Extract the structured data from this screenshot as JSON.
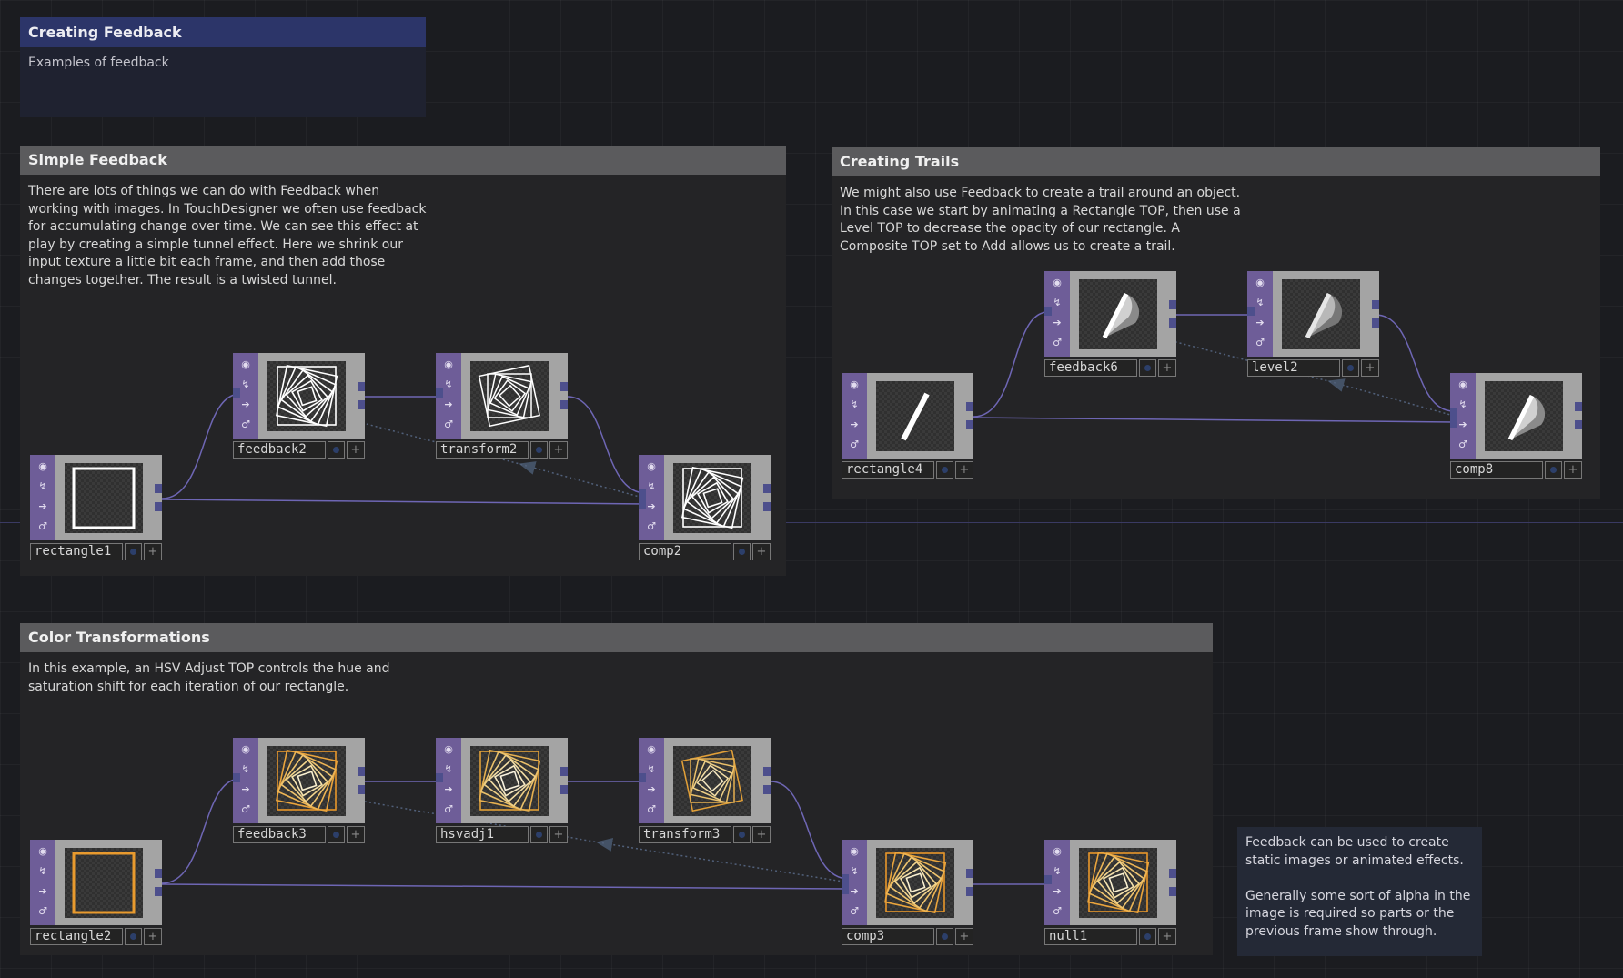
{
  "title_box": {
    "title": "Creating Feedback",
    "subtitle": "Examples of feedback"
  },
  "panels": {
    "simple": {
      "title": "Simple Feedback",
      "text": "There are lots of things we can do with Feedback when\nworking with images. In TouchDesigner we often use feedback\nfor accumulating change over time. We can see this effect at\nplay by creating a simple tunnel effect. Here we shrink our\ninput texture a little bit each frame, and then add those\nchanges together. The result is a twisted tunnel."
    },
    "trails": {
      "title": "Creating Trails",
      "text": "We might also use Feedback to create a trail around an object.\nIn this case we start by animating a Rectangle TOP, then use a\nLevel TOP to decrease the opacity of our rectangle. A\nComposite TOP set to Add allows us to create a trail."
    },
    "color": {
      "title": "Color Transformations",
      "text": "In this example, an HSV Adjust TOP controls the hue and\nsaturation shift for each iteration of our rectangle."
    }
  },
  "note": {
    "text": "Feedback can be used to create\nstatic images or animated effects.\n\nGenerally some sort of alpha in the\nimage is required so parts or the\nprevious frame show through."
  },
  "nodes": {
    "rectangle1": "rectangle1",
    "feedback2": "feedback2",
    "transform2": "transform2",
    "comp2": "comp2",
    "rectangle4": "rectangle4",
    "feedback6": "feedback6",
    "level2": "level2",
    "comp8": "comp8",
    "rectangle2": "rectangle2",
    "feedback3": "feedback3",
    "hsvadj1": "hsvadj1",
    "transform3": "transform3",
    "comp3": "comp3",
    "null1": "null1"
  },
  "node_button_plus": "+",
  "icons": {
    "strip": [
      "viewer-icon",
      "cook-icon",
      "bypass-icon",
      "lock-icon"
    ],
    "strip_glyphs": [
      "◉",
      "↯",
      "➔",
      "♂"
    ]
  },
  "colors": {
    "operator_strip": "#6e5d98",
    "wire": "#6e66b4",
    "title_header": "#2c3569",
    "panel_header": "#5b5b5d",
    "orange": "#e89a2e"
  }
}
